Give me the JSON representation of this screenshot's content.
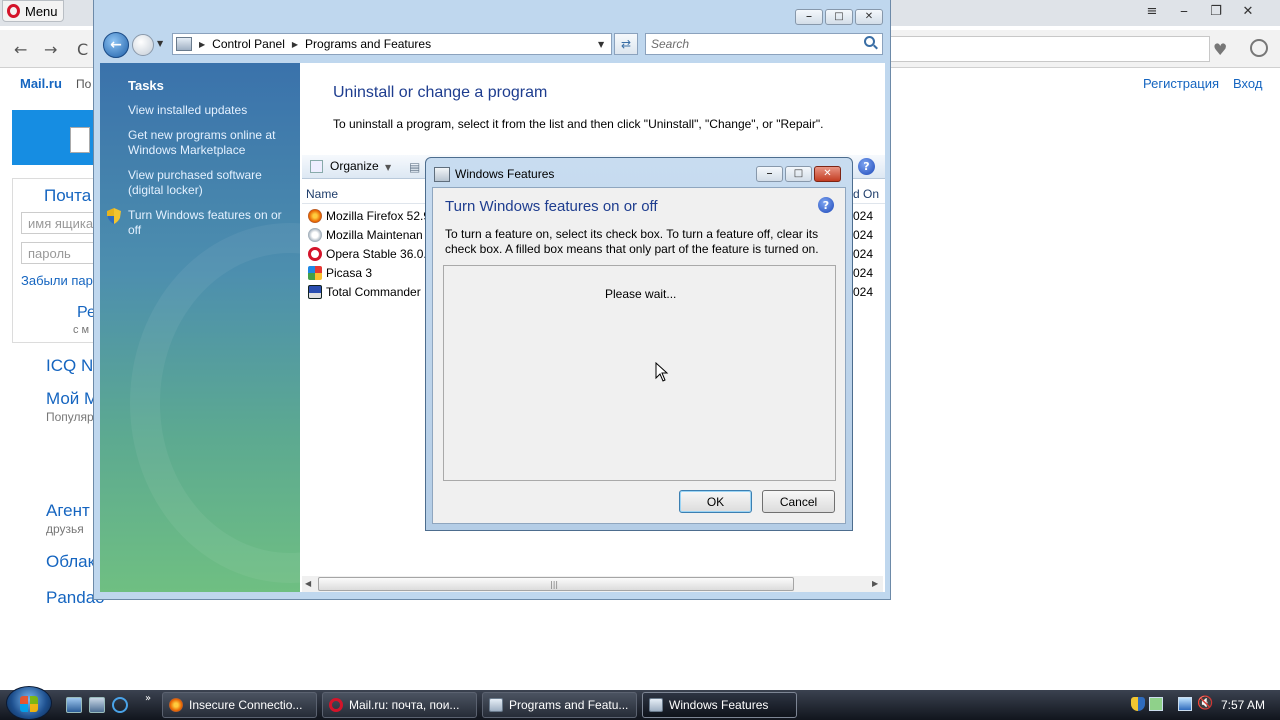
{
  "opera": {
    "menu_label": "Menu",
    "mail_logo": "Mail.ru",
    "mail_po": "По",
    "registration": "Регистрация",
    "login": "Вход",
    "pochta": "Почта",
    "login_placeholder": "имя ящика",
    "password_placeholder": "пароль",
    "forgot": "Забыли пар",
    "re": "Ре",
    "sm": "с м",
    "icq": "ICQ N",
    "moy": "Мой М",
    "popular": "Популяр",
    "agent": "Агент",
    "druzya": "друзья",
    "oblako": "Облак",
    "pandao": "Pandao"
  },
  "pf_window": {
    "breadcrumb": [
      "Control Panel",
      "Programs and Features"
    ],
    "search_placeholder": "Search",
    "sidebar": {
      "title": "Tasks",
      "links": [
        "View installed updates",
        "Get new programs online at Windows Marketplace",
        "View purchased software (digital locker)",
        "Turn Windows features on or off"
      ]
    },
    "heading": "Uninstall or change a program",
    "description": "To uninstall a program, select it from the list and then click \"Uninstall\", \"Change\", or \"Repair\".",
    "organize_label": "Organize",
    "columns": {
      "name": "Name",
      "installed_on": "d On"
    },
    "programs": [
      {
        "name": "Mozilla Firefox 52.9",
        "date": "024",
        "icon_color": "#e66000"
      },
      {
        "name": "Mozilla Maintenan",
        "date": "024",
        "icon_color": "#9aa8b5"
      },
      {
        "name": "Opera Stable 36.0.2",
        "date": "024",
        "icon_color": "#d4142a"
      },
      {
        "name": "Picasa 3",
        "date": "024",
        "icon_color": "#4a8f3c"
      },
      {
        "name": "Total Commander",
        "date": "024",
        "icon_color": "#2a4db0"
      }
    ]
  },
  "dialog": {
    "title": "Windows Features",
    "heading": "Turn Windows features on or off",
    "description": "To turn a feature on, select its check box. To turn a feature off, clear its check box. A filled box means that only part of the feature is turned on.",
    "status": "Please wait...",
    "ok_label": "OK",
    "cancel_label": "Cancel"
  },
  "taskbar": {
    "buttons": [
      {
        "label": "Insecure Connectio...",
        "icon_color": "#e66000"
      },
      {
        "label": "Mail.ru: почта, пои...",
        "icon_color": "#d4142a"
      },
      {
        "label": "Programs and Featu...",
        "icon_color": "#9fb0c3"
      },
      {
        "label": "Windows Features",
        "icon_color": "#9fb0c3"
      }
    ],
    "clock": "7:57 AM"
  }
}
